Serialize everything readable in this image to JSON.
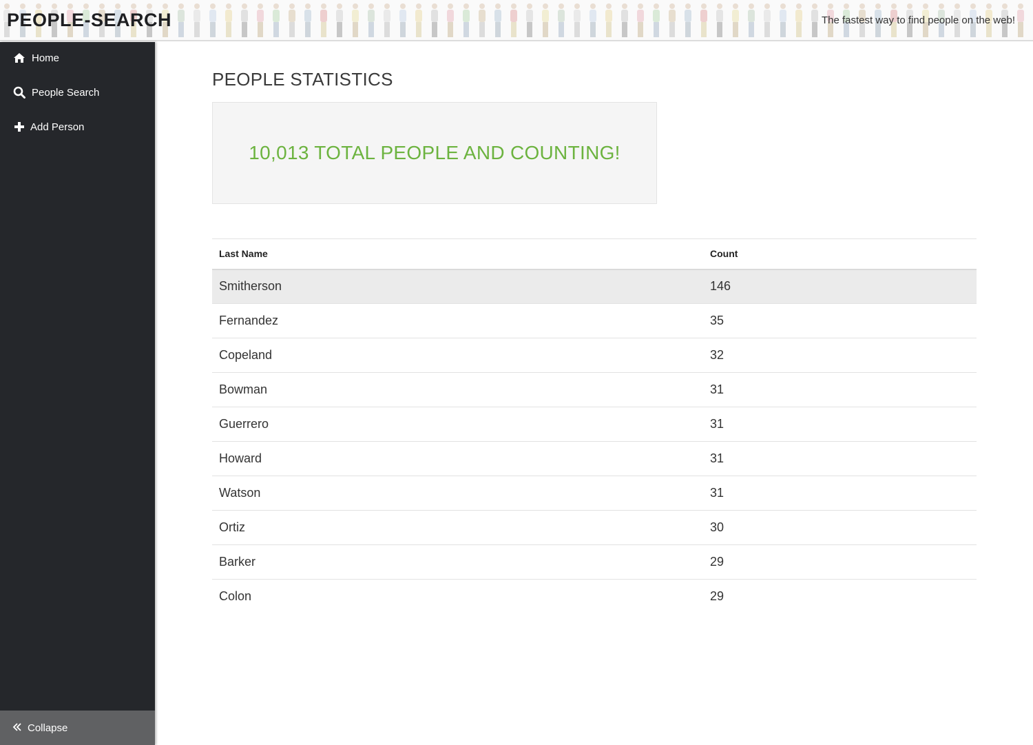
{
  "header": {
    "brand": "PEOPLE-SEARCH",
    "tagline": "The fastest way to find people on the web!"
  },
  "sidebar": {
    "items": [
      {
        "label": "Home",
        "icon": "home-icon"
      },
      {
        "label": "People Search",
        "icon": "search-icon"
      },
      {
        "label": "Add Person",
        "icon": "plus-icon"
      }
    ],
    "collapse_label": "Collapse"
  },
  "main": {
    "title": "PEOPLE STATISTICS",
    "total_banner": "10,013 TOTAL PEOPLE AND COUNTING!",
    "table": {
      "columns": [
        "Last Name",
        "Count"
      ],
      "rows": [
        {
          "name": "Smitherson",
          "count": "146"
        },
        {
          "name": "Fernandez",
          "count": "35"
        },
        {
          "name": "Copeland",
          "count": "32"
        },
        {
          "name": "Bowman",
          "count": "31"
        },
        {
          "name": "Guerrero",
          "count": "31"
        },
        {
          "name": "Howard",
          "count": "31"
        },
        {
          "name": "Watson",
          "count": "31"
        },
        {
          "name": "Ortiz",
          "count": "30"
        },
        {
          "name": "Barker",
          "count": "29"
        },
        {
          "name": "Colon",
          "count": "29"
        }
      ]
    }
  },
  "colors": {
    "sidebar_bg": "#25272b",
    "collapse_bg": "#606163",
    "accent_green": "#6cb33f",
    "highlight_row": "#ebebeb"
  }
}
